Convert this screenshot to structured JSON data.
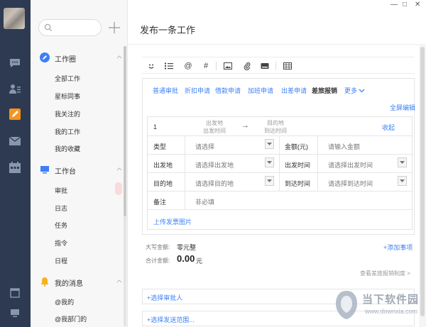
{
  "header": {
    "title": "发布一条工作"
  },
  "window": {
    "minimize": "—",
    "maximize": "□",
    "close": "✕"
  },
  "rail": {
    "icons": [
      "chat-icon",
      "contacts-icon",
      "work-icon",
      "mail-icon",
      "calendar-icon",
      "window-icon",
      "screen-icon"
    ]
  },
  "sidebar": {
    "search": {
      "placeholder": ""
    },
    "sections": [
      {
        "label": "工作圈",
        "icon": "pencil-icon",
        "items": [
          "全部工作",
          "星标同事",
          "我关注的",
          "我的工作",
          "我的收藏"
        ]
      },
      {
        "label": "工作台",
        "icon": "monitor-icon",
        "items": [
          "审批",
          "日志",
          "任务",
          "指令",
          "日程"
        ]
      },
      {
        "label": "我的消息",
        "icon": "bell-icon",
        "items": [
          "@我的",
          "@我部门的"
        ]
      }
    ]
  },
  "toolbar": {
    "icons": [
      "smile-icon",
      "list-icon",
      "at-icon",
      "hash-icon",
      "image-icon",
      "attachment-icon",
      "drive-icon",
      "table-icon"
    ],
    "at": "@",
    "hash": "#"
  },
  "tabs": [
    "普通审批",
    "折扣申请",
    "借款申请",
    "加班申请",
    "出差申请",
    "差旅报销",
    "更多"
  ],
  "active_tab": "差旅报销",
  "form": {
    "fullscreen": "全屏编辑",
    "index": "1",
    "from_top": "出发地",
    "from_bottom": "出发时间",
    "arrow": "→",
    "to_top": "目的地",
    "to_bottom": "到达时间",
    "collapse": "收起",
    "type_label": "类型",
    "type_placeholder": "请选择",
    "amount_label": "金额(元)",
    "amount_placeholder": "请输入金额",
    "from_label": "出发地",
    "from_placeholder": "请选择出发地",
    "depart_time_label": "出发时间",
    "depart_time_placeholder": "请选择出发时间",
    "to_label": "目的地",
    "to_placeholder": "请选择目的地",
    "arrive_time_label": "到达时间",
    "arrive_time_placeholder": "请选择到达时间",
    "note_label": "备注",
    "note_placeholder": "非必填",
    "upload": "上传发票图片"
  },
  "summary": {
    "words_label": "大写金额:",
    "words_value": "零元整",
    "total_label": "合计金额:",
    "total_value": "0.00",
    "total_unit": "元",
    "add_item": "+添加事项",
    "policy": "查看差旅报销制度 >"
  },
  "approver": "+选择审批人",
  "scope": "+选择发送范围...",
  "watermark": {
    "text": "当下软件园",
    "url": "www.downxia.com"
  },
  "colors": {
    "rail": "#2d3a52",
    "accent": "#3d7ff5",
    "active_icon": "#f7941d"
  }
}
